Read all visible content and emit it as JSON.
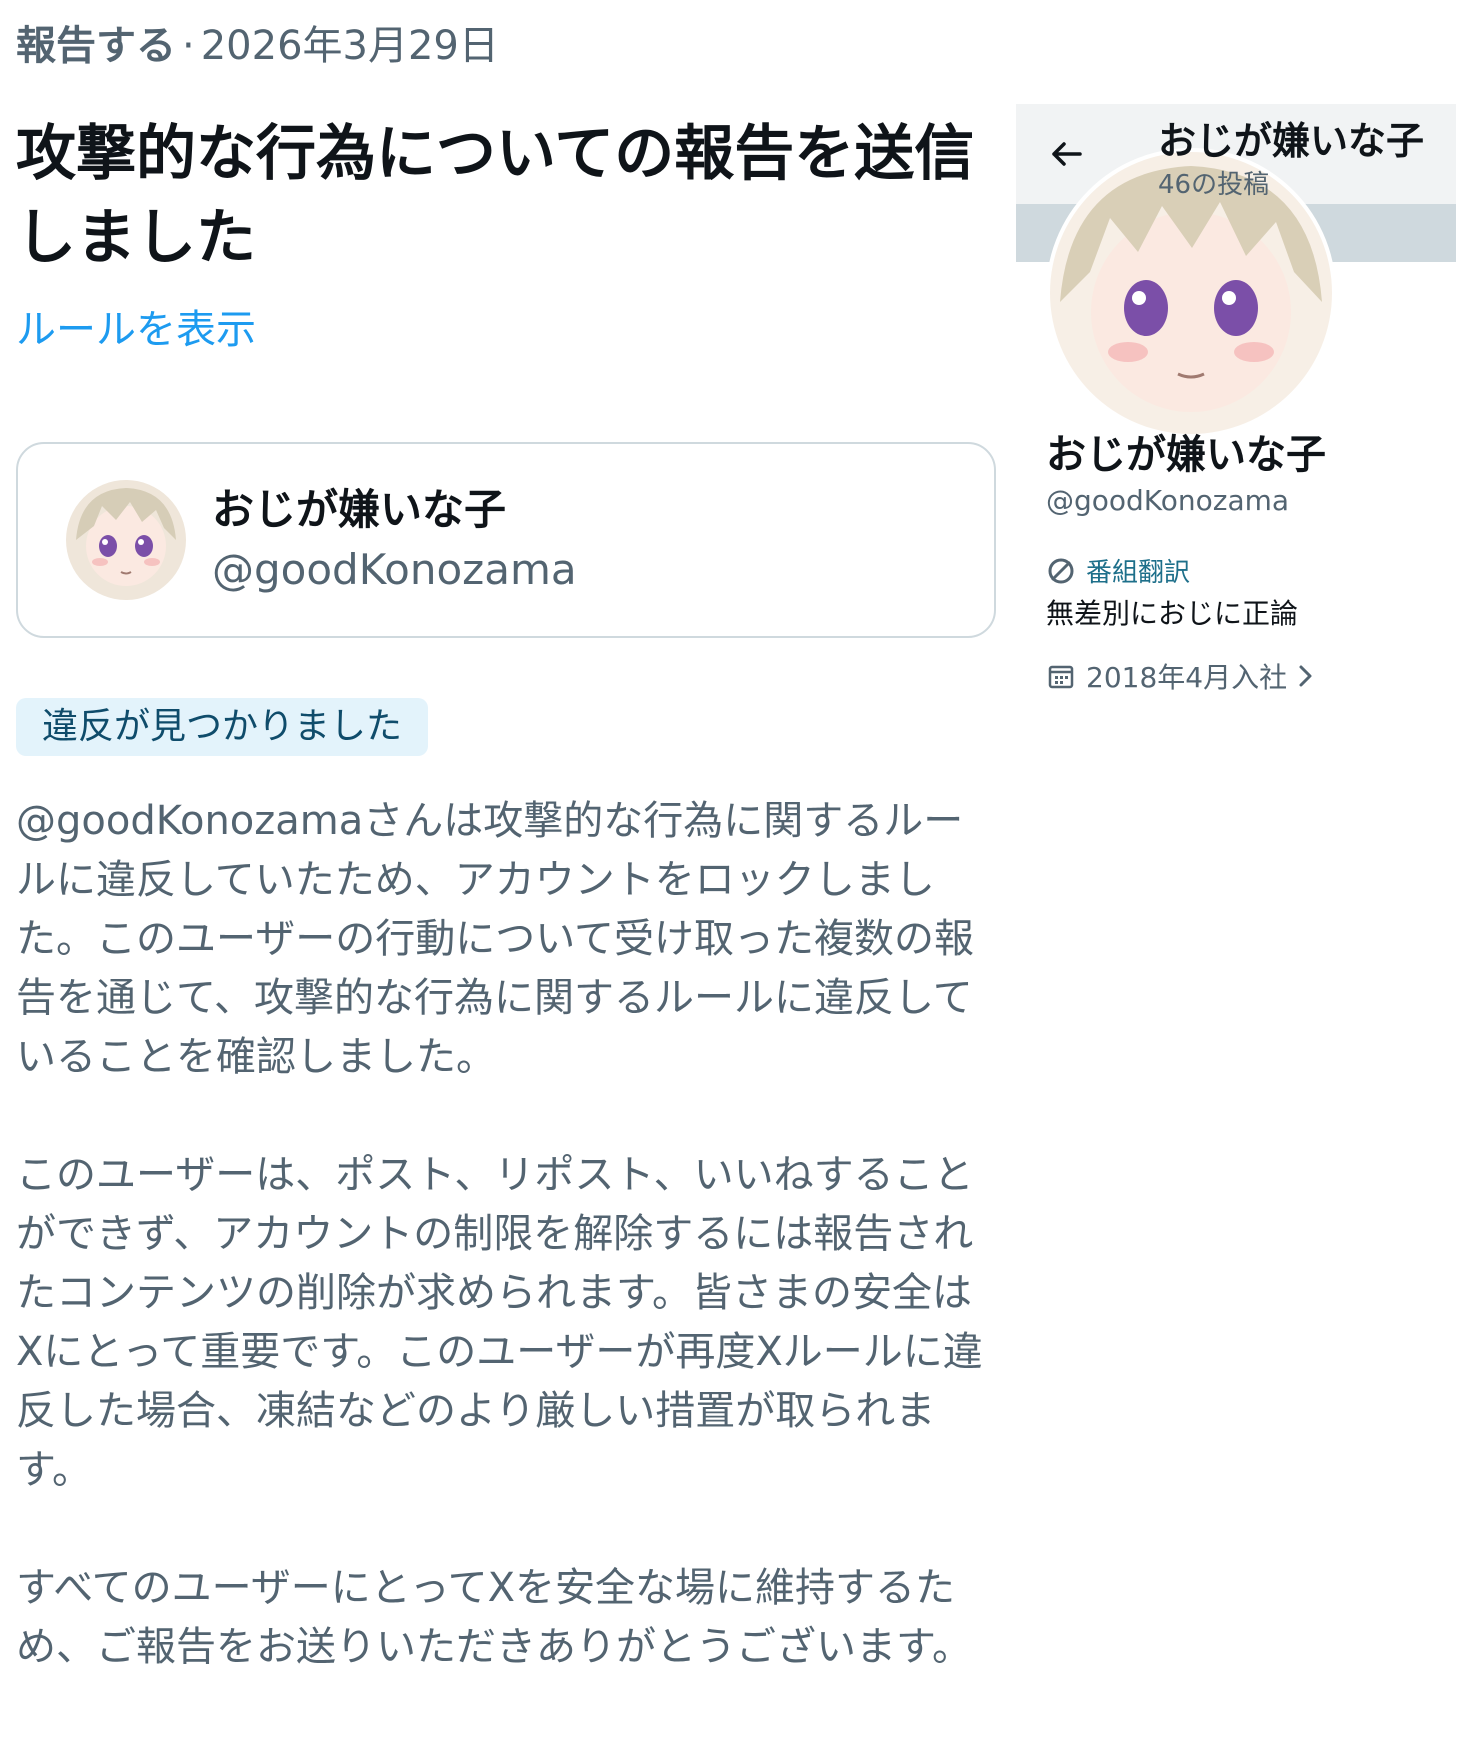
{
  "report": {
    "type_label": "報告する",
    "separator": "·",
    "date": "2026年3月29日",
    "title": "攻撃的な行為についての報告を送信しました",
    "rules_link": "ルールを表示"
  },
  "reported_user": {
    "name": "おじが嫌いな子",
    "handle": "@goodKonozama"
  },
  "status_badge": "違反が見つかりました",
  "body_paragraphs": [
    "@goodKonozamaさんは攻撃的な行為に関するルールに違反していたため、アカウントをロックしました。このユーザーの行動について受け取った複数の報告を通じて、攻撃的な行為に関するルールに違反していることを確認しました。",
    "このユーザーは、ポスト、リポスト、いいねすることができず、アカウントの制限を解除するには報告されたコンテンツの削除が求められます。皆さまの安全はXにとって重要です。このユーザーが再度Xルールに違反した場合、凍結などのより厳しい措置が取られます。",
    "すべてのユーザーにとってXを安全な場に維持するため、ご報告をお送りいただきありがとうございます。"
  ],
  "profile": {
    "header_name": "おじが嫌いな子",
    "post_count": "46の投稿",
    "name": "おじが嫌いな子",
    "handle": "@goodKonozama",
    "category": "番組翻訳",
    "bio": "無差別におじに正論",
    "joined": "2018年4月入社",
    "icons": {
      "back": "arrow-left-icon",
      "category": "no-entry-icon",
      "joined": "calendar-icon",
      "more": "chevron-right-icon"
    }
  },
  "colors": {
    "link": "#1d9bf0",
    "badge_bg": "#e3f3fb",
    "muted_text": "#536471",
    "banner": "#cfd9de"
  }
}
